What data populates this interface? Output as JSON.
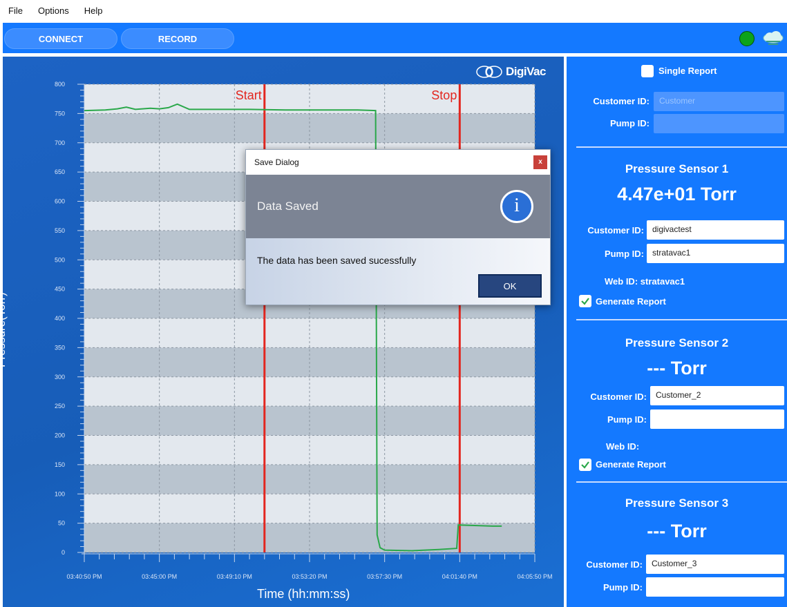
{
  "menu": {
    "file": "File",
    "options": "Options",
    "help": "Help"
  },
  "toolbar": {
    "connect_label": "CONNECT",
    "record_label": "RECORD",
    "status_color": "#0ca31a"
  },
  "brand": {
    "name": "DigiVac"
  },
  "chart_data": {
    "type": "line",
    "xlabel": "Time (hh:mm:ss)",
    "ylabel": "Pressure(Torr)",
    "x_ticks": [
      "03:40:50 PM",
      "03:45:00 PM",
      "03:49:10 PM",
      "03:53:20 PM",
      "03:57:30 PM",
      "04:01:40 PM",
      "04:05:50 PM"
    ],
    "y_ticks": [
      0,
      50,
      100,
      150,
      200,
      250,
      300,
      350,
      400,
      450,
      500,
      550,
      600,
      650,
      700,
      750,
      800
    ],
    "ylim": [
      0,
      800
    ],
    "xlim": [
      "03:40:50 PM",
      "04:05:50 PM"
    ],
    "grid": true,
    "series": [
      {
        "color": "#2aa84a",
        "x": [
          "03:40:50 PM",
          "03:42:00 PM",
          "03:42:40 PM",
          "03:43:10 PM",
          "03:43:40 PM",
          "03:44:30 PM",
          "03:45:00 PM",
          "03:45:30 PM",
          "03:46:00 PM",
          "03:46:40 PM",
          "03:47:30 PM",
          "03:48:30 PM",
          "03:50:00 PM",
          "03:52:00 PM",
          "03:54:00 PM",
          "03:56:00 PM",
          "03:57:00 PM",
          "03:57:05 PM",
          "03:57:15 PM",
          "03:57:30 PM",
          "03:59:00 PM",
          "04:00:30 PM",
          "04:01:30 PM",
          "04:01:35 PM",
          "04:02:30 PM",
          "04:03:30 PM",
          "04:04:00 PM"
        ],
        "y": [
          755,
          756,
          758,
          761,
          757,
          759,
          758,
          760,
          766,
          757,
          757,
          757,
          757,
          756,
          756,
          756,
          755,
          30,
          8,
          4,
          3,
          5,
          7,
          47,
          46,
          45,
          45
        ]
      }
    ],
    "markers": [
      {
        "label": "Start",
        "x": "03:50:50 PM",
        "color": "#e3261f"
      },
      {
        "label": "Stop",
        "x": "04:01:40 PM",
        "color": "#e3261f"
      }
    ]
  },
  "dialog": {
    "title": "Save Dialog",
    "close_label": "x",
    "heading": "Data Saved",
    "info_glyph": "i",
    "message": "The data has been saved sucessfully",
    "ok_label": "OK"
  },
  "report": {
    "single_report_label": "Single Report",
    "single_report_checked": false,
    "customer_id_label": "Customer ID:",
    "customer_id_placeholder": "Customer",
    "pump_id_label": "Pump ID:",
    "pump_id_value": ""
  },
  "sensors": [
    {
      "title": "Pressure Sensor 1",
      "value": "4.47e+01 Torr",
      "customer_label": "Customer ID:",
      "customer_value": "digivactest",
      "pump_label": "Pump ID:",
      "pump_value": "stratavac1",
      "web_label": "Web ID:",
      "web_value": "stratavac1",
      "generate_label": "Generate Report",
      "generate_checked": true
    },
    {
      "title": "Pressure Sensor 2",
      "value": "--- Torr",
      "customer_label": "Customer ID:",
      "customer_value": "Customer_2",
      "pump_label": "Pump ID:",
      "pump_value": "",
      "web_label": "Web ID:",
      "web_value": "",
      "generate_label": "Generate Report",
      "generate_checked": true
    },
    {
      "title": "Pressure Sensor 3",
      "value": "--- Torr",
      "customer_label": "Customer ID:",
      "customer_value": "Customer_3",
      "pump_label": "Pump ID:",
      "pump_value": ""
    }
  ]
}
